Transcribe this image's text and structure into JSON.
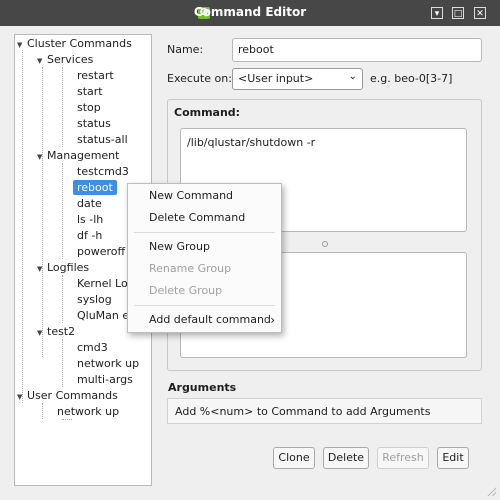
{
  "window": {
    "title": "Command Editor",
    "app_icon_letter": "Q"
  },
  "tree": {
    "cluster_commands": "Cluster Commands",
    "services": "Services",
    "restart": "restart",
    "start": "start",
    "stop": "stop",
    "status": "status",
    "status_all": "status-all",
    "management": "Management",
    "testcmd3": "testcmd3",
    "reboot": "reboot",
    "date": "date",
    "ls_lh": "ls -lh",
    "df_h": "df -h",
    "poweroff": "poweroff",
    "logfiles": "Logfiles",
    "kernel_log": "Kernel Lo",
    "syslog": "syslog",
    "qluman": "QluMan e",
    "test2": "test2",
    "cmd3": "cmd3",
    "network_up": "network up",
    "multi_args": "multi-args",
    "user_commands": "User Commands",
    "user_network_up": "network up"
  },
  "form": {
    "name_label": "Name:",
    "name_value": "reboot",
    "execute_label": "Execute on:",
    "execute_value": "<User input>",
    "execute_example": "e.g. beo-0[3-7]",
    "command_label": "Command:",
    "command_value": "/lib/qlustar/shutdown -r",
    "arguments_label": "Arguments",
    "arguments_hint": "Add %<num> to Command to add Arguments"
  },
  "buttons": {
    "clone": "Clone",
    "delete": "Delete",
    "refresh": "Refresh",
    "edit": "Edit"
  },
  "context_menu": {
    "new_command": "New Command",
    "delete_command": "Delete Command",
    "new_group": "New Group",
    "rename_group": "Rename Group",
    "delete_group": "Delete Group",
    "add_default": "Add default command"
  },
  "colors": {
    "selection": "#3d8ee6",
    "titlebar": "#474747",
    "app_icon": "#6fc22f"
  }
}
